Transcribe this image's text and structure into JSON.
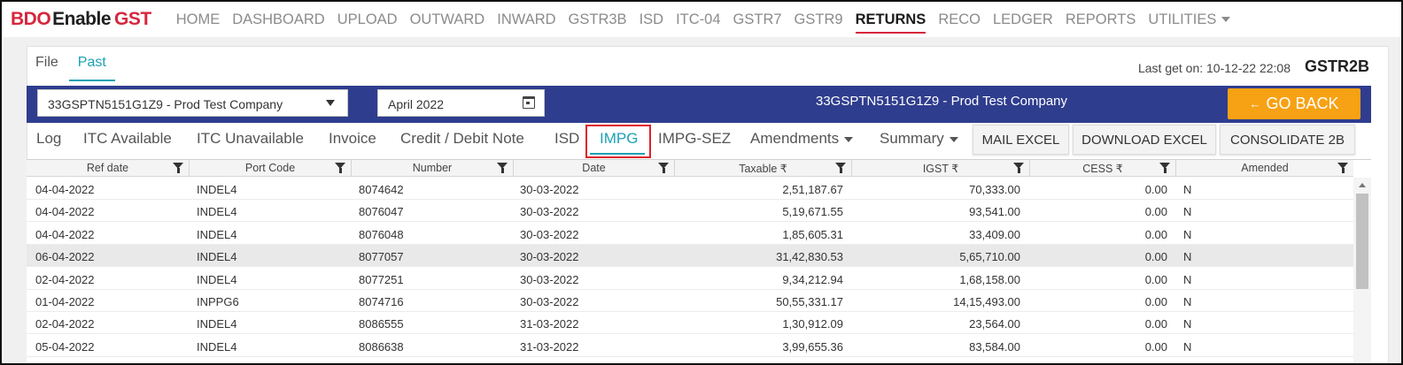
{
  "brand": {
    "part1": "BDO",
    "part2": "Enable",
    "part3": "GST"
  },
  "nav": [
    {
      "label": "HOME",
      "active": false
    },
    {
      "label": "DASHBOARD",
      "active": false
    },
    {
      "label": "UPLOAD",
      "active": false
    },
    {
      "label": "OUTWARD",
      "active": false
    },
    {
      "label": "INWARD",
      "active": false
    },
    {
      "label": "GSTR3B",
      "active": false
    },
    {
      "label": "ISD",
      "active": false
    },
    {
      "label": "ITC-04",
      "active": false
    },
    {
      "label": "GSTR7",
      "active": false
    },
    {
      "label": "GSTR9",
      "active": false
    },
    {
      "label": "RETURNS",
      "active": true
    },
    {
      "label": "RECO",
      "active": false
    },
    {
      "label": "LEDGER",
      "active": false
    },
    {
      "label": "REPORTS",
      "active": false
    },
    {
      "label": "UTILITIES",
      "active": false,
      "dropdown": true
    }
  ],
  "subtabs": {
    "file": "File",
    "past": "Past"
  },
  "header": {
    "last_get": "Last get on: 10-12-22 22:08",
    "return_type": "GSTR2B"
  },
  "toolbar": {
    "company_select": "33GSPTN5151G1Z9 - Prod Test Company",
    "period": "April 2022",
    "company_title": "33GSPTN5151G1Z9 - Prod Test Company",
    "go_back": "GO BACK",
    "go_back_arrow": "←"
  },
  "tabs": {
    "log": "Log",
    "itc_available": "ITC Available",
    "itc_unavailable": "ITC Unavailable",
    "invoice": "Invoice",
    "cdn": "Credit / Debit Note",
    "isd": "ISD",
    "impg": "IMPG",
    "impg_sez": "IMPG-SEZ",
    "amendments": "Amendments",
    "summary": "Summary"
  },
  "actions": {
    "mail_excel": "MAIL EXCEL",
    "download_excel": "DOWNLOAD EXCEL",
    "consolidate": "CONSOLIDATE 2B"
  },
  "table": {
    "headers": {
      "ref_date": "Ref date",
      "port_code": "Port Code",
      "number": "Number",
      "date": "Date",
      "taxable": "Taxable ₹",
      "igst": "IGST ₹",
      "cess": "CESS ₹",
      "amended": "Amended"
    },
    "rows": [
      {
        "ref_date": "04-04-2022",
        "port_code": "INDEL4",
        "number": "8074642",
        "date": "30-03-2022",
        "taxable": "2,51,187.67",
        "igst": "70,333.00",
        "cess": "0.00",
        "amended": "N"
      },
      {
        "ref_date": "04-04-2022",
        "port_code": "INDEL4",
        "number": "8076047",
        "date": "30-03-2022",
        "taxable": "5,19,671.55",
        "igst": "93,541.00",
        "cess": "0.00",
        "amended": "N"
      },
      {
        "ref_date": "04-04-2022",
        "port_code": "INDEL4",
        "number": "8076048",
        "date": "30-03-2022",
        "taxable": "1,85,605.31",
        "igst": "33,409.00",
        "cess": "0.00",
        "amended": "N"
      },
      {
        "ref_date": "06-04-2022",
        "port_code": "INDEL4",
        "number": "8077057",
        "date": "30-03-2022",
        "taxable": "31,42,830.53",
        "igst": "5,65,710.00",
        "cess": "0.00",
        "amended": "N"
      },
      {
        "ref_date": "02-04-2022",
        "port_code": "INDEL4",
        "number": "8077251",
        "date": "30-03-2022",
        "taxable": "9,34,212.94",
        "igst": "1,68,158.00",
        "cess": "0.00",
        "amended": "N"
      },
      {
        "ref_date": "01-04-2022",
        "port_code": "INPPG6",
        "number": "8074716",
        "date": "30-03-2022",
        "taxable": "50,55,331.17",
        "igst": "14,15,493.00",
        "cess": "0.00",
        "amended": "N"
      },
      {
        "ref_date": "02-04-2022",
        "port_code": "INDEL4",
        "number": "8086555",
        "date": "31-03-2022",
        "taxable": "1,30,912.09",
        "igst": "23,564.00",
        "cess": "0.00",
        "amended": "N"
      },
      {
        "ref_date": "05-04-2022",
        "port_code": "INDEL4",
        "number": "8086638",
        "date": "31-03-2022",
        "taxable": "3,99,655.36",
        "igst": "83,584.00",
        "cess": "0.00",
        "amended": "N"
      }
    ]
  }
}
